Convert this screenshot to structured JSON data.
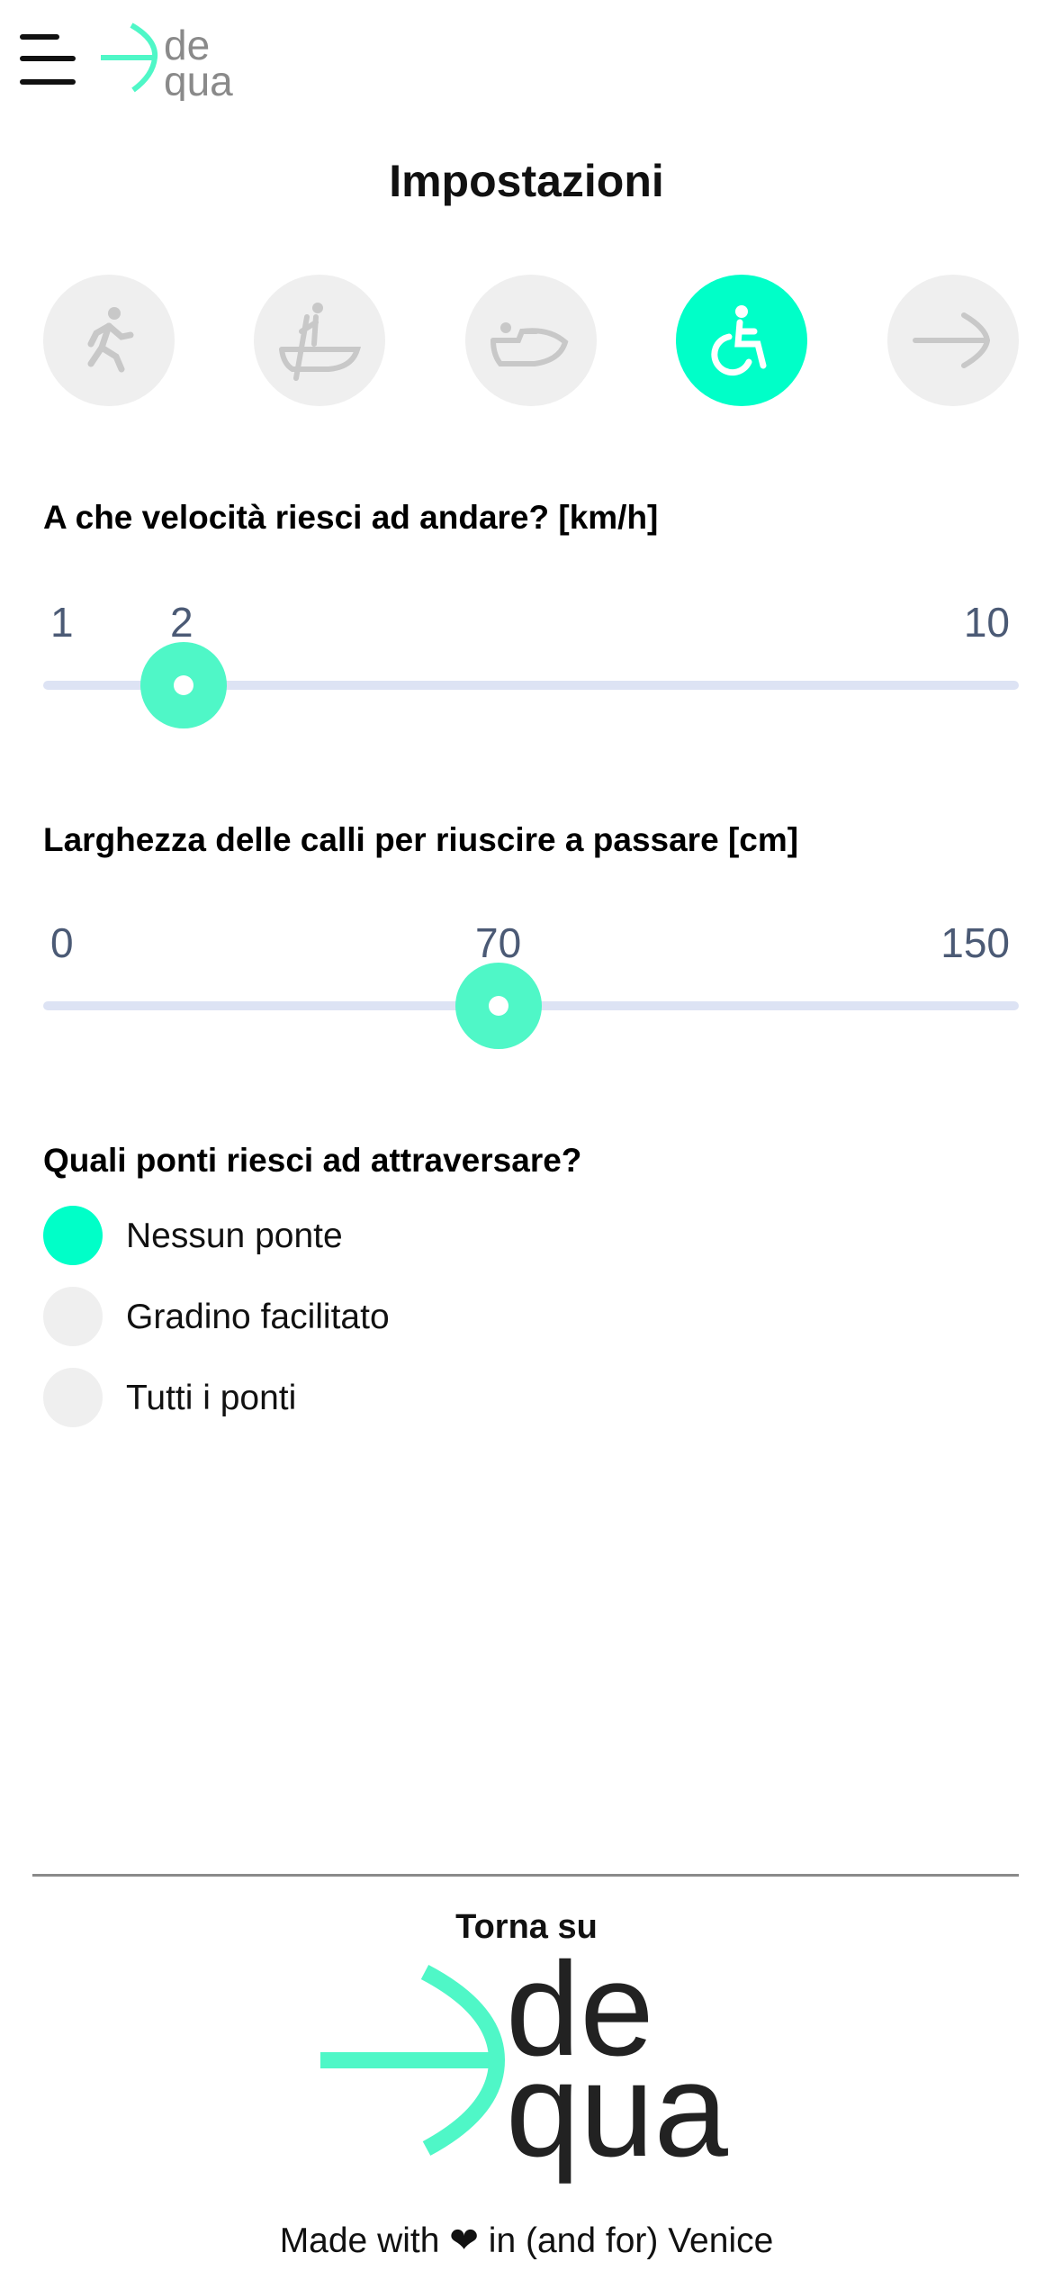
{
  "header": {
    "menu_icon": "hamburger-menu-icon",
    "logo_text": [
      "de",
      "qua"
    ]
  },
  "page": {
    "title": "Impostazioni"
  },
  "modes": [
    {
      "icon": "walking-person-icon",
      "selected": false
    },
    {
      "icon": "standing-rowing-boat-icon",
      "selected": false
    },
    {
      "icon": "seated-boat-icon",
      "selected": false
    },
    {
      "icon": "wheelchair-icon",
      "selected": true
    },
    {
      "icon": "arrow-right-icon",
      "selected": false
    }
  ],
  "speed": {
    "question": "A che velocità riesci ad andare? [km/h]",
    "min_label": "1",
    "max_label": "10",
    "value_label": "2",
    "min": 1,
    "max": 10,
    "value": 2
  },
  "width": {
    "question": "Larghezza delle calli per riuscire a passare [cm]",
    "min_label": "0",
    "max_label": "150",
    "value_label": "70",
    "min": 0,
    "max": 150,
    "value": 70
  },
  "bridges": {
    "question": "Quali ponti riesci ad attraversare?",
    "options": [
      {
        "label": "Nessun ponte",
        "selected": true
      },
      {
        "label": "Gradino facilitato",
        "selected": false
      },
      {
        "label": "Tutti i ponti",
        "selected": false
      }
    ]
  },
  "footer": {
    "back_to_top": "Torna su",
    "logo_text": [
      "de",
      "qua"
    ],
    "credit": "Made with ❤ in (and for) Venice"
  },
  "colors": {
    "accent": "#00ffc8",
    "slider_thumb": "#4ff7c7",
    "track": "#dde3f4",
    "inactive": "#efefef"
  }
}
